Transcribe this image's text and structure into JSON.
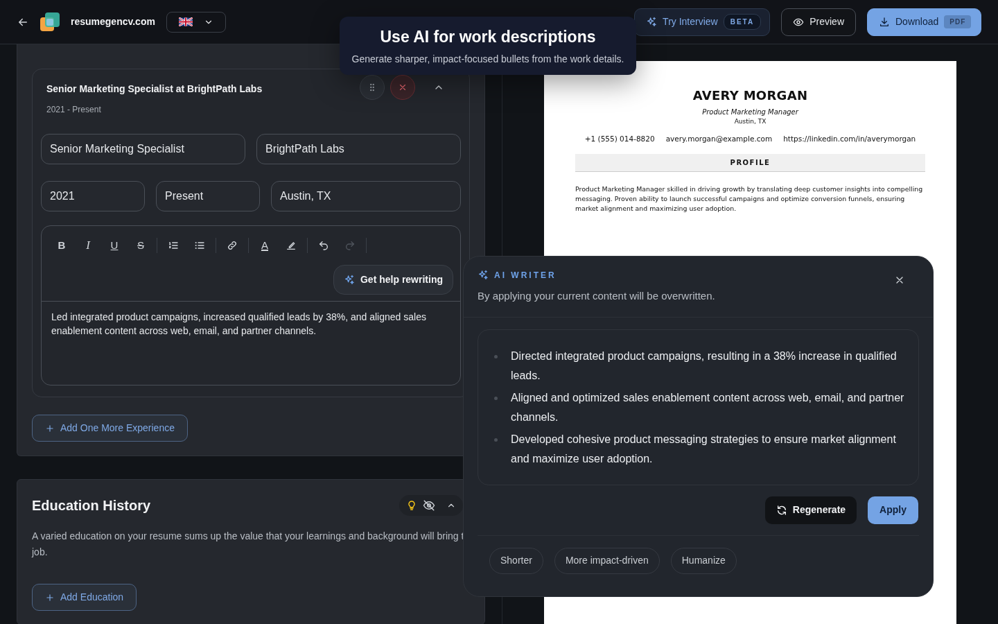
{
  "header": {
    "site": "resumegencv.com",
    "buttons": [
      {
        "kind": "interview",
        "label": "Try Interview",
        "badge": "BETA"
      },
      {
        "kind": "preview",
        "label": "Preview"
      },
      {
        "kind": "download",
        "label": "Download",
        "badge": "PDF"
      }
    ]
  },
  "tooltip": {
    "title": "Use AI for work descriptions",
    "text": "Generate sharper, impact-focused bullets from the work details."
  },
  "experience": {
    "entry": {
      "title": "Senior Marketing Specialist at BrightPath Labs",
      "dates": "2021 - Present",
      "fields": [
        [
          "Senior Marketing Specialist",
          "BrightPath Labs"
        ],
        [
          "2021",
          "Present",
          "Austin, TX"
        ]
      ],
      "toolbar": [
        {
          "kind": "bold",
          "glyph": "B",
          "disabled": false
        },
        {
          "kind": "italic",
          "glyph": "I",
          "disabled": false
        },
        {
          "kind": "underline",
          "glyph": "U",
          "disabled": false
        },
        {
          "kind": "strike",
          "glyph": "S",
          "disabled": false
        },
        {
          "kind": "sep"
        },
        {
          "kind": "ordered",
          "disabled": false
        },
        {
          "kind": "bullets",
          "disabled": false
        },
        {
          "kind": "sep"
        },
        {
          "kind": "link",
          "disabled": false
        },
        {
          "kind": "sep"
        },
        {
          "kind": "color",
          "glyph": "A",
          "disabled": false
        },
        {
          "kind": "highlight",
          "disabled": false
        },
        {
          "kind": "sep"
        },
        {
          "kind": "undo",
          "disabled": false
        },
        {
          "kind": "redo",
          "disabled": true
        },
        {
          "kind": "sep"
        }
      ],
      "rewrite_button": "Get help rewriting",
      "description": "Led integrated product campaigns, increased qualified leads by 38%, and aligned sales enablement content across web, email, and partner channels."
    },
    "add_button": "Add One More Experience"
  },
  "education": {
    "title": "Education History",
    "description_lines": [
      "A varied education on your resume sums up the value that your learnings and background will bring t",
      "job."
    ],
    "add_button": "Add Education"
  },
  "resume": {
    "name": "AVERY MORGAN",
    "title": "Product Marketing Manager",
    "location": "Austin, TX",
    "contacts": [
      "+1 (555) 014-8820",
      "avery.morgan@example.com",
      "https://linkedin.com/in/averymorgan"
    ],
    "sections": [
      {
        "heading": "PROFILE",
        "text": "Product Marketing Manager skilled in driving growth by translating deep customer insights into compelling messaging. Proven ability to launch successful campaigns and optimize conversion funnels, ensuring market alignment and maximizing user adoption."
      }
    ]
  },
  "ai_writer": {
    "label": "AI WRITER",
    "notice": "By applying your current content will be overwritten.",
    "suggestions": [
      "Directed integrated product campaigns, resulting in a 38% increase in qualified leads.",
      "Aligned and optimized sales enablement content across web, email, and partner channels.",
      "Developed cohesive product messaging strategies to ensure market alignment and maximize user adoption."
    ],
    "regenerate": "Regenerate",
    "apply": "Apply",
    "chips": [
      "Shorter",
      "More impact-driven",
      "Humanize"
    ]
  }
}
